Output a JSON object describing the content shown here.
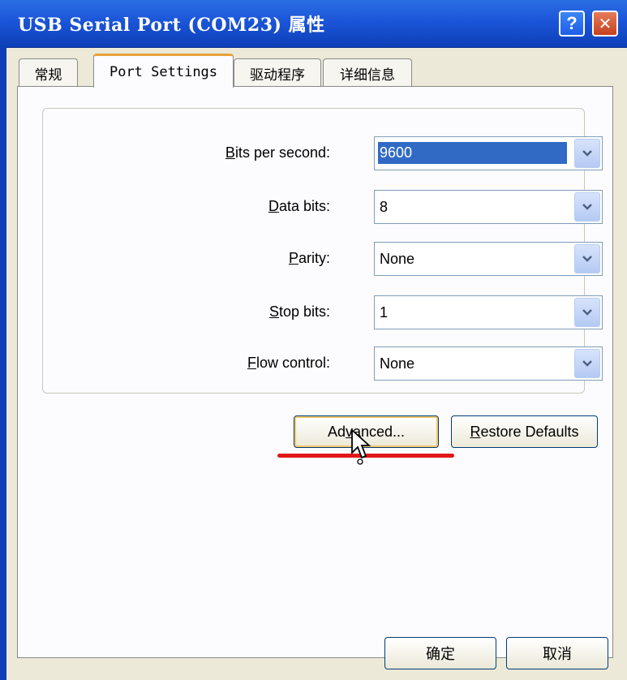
{
  "window": {
    "title": "USB Serial Port (COM23) 属性",
    "help_icon_label": "?",
    "close_icon_label": "✕"
  },
  "tabs": [
    {
      "label": "常规",
      "active": false
    },
    {
      "label": "Port Settings",
      "active": true
    },
    {
      "label": "驱动程序",
      "active": false
    },
    {
      "label": "详细信息",
      "active": false
    }
  ],
  "settings": {
    "bits_per_second": {
      "label_key": "B",
      "label_rest": "its per second:",
      "value": "9600"
    },
    "data_bits": {
      "label_key": "D",
      "label_rest": "ata bits:",
      "value": "8"
    },
    "parity": {
      "label_key": "P",
      "label_rest": "arity:",
      "value": "None"
    },
    "stop_bits": {
      "label_key": "S",
      "label_rest": "top bits:",
      "value": "1"
    },
    "flow_control": {
      "label_key": "F",
      "label_rest": "low control:",
      "value": "None"
    }
  },
  "buttons": {
    "advanced": {
      "prefix": "Ad",
      "key": "v",
      "suffix": "anced..."
    },
    "restore_defaults": {
      "key": "R",
      "suffix": "estore Defaults"
    },
    "ok": "确定",
    "cancel": "取消"
  },
  "colors": {
    "titlebar": "#1b55d8",
    "selection": "#316ac5",
    "annotation_underline": "#e01818",
    "active_tab_accent": "#e8a23a"
  }
}
